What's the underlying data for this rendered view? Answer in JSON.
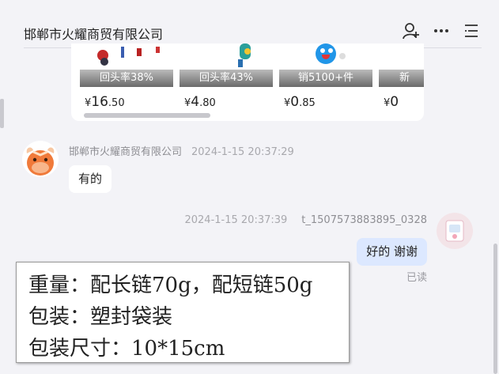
{
  "header": {
    "title": "邯郸市火耀商贸有限公司",
    "icons": [
      "add-user-icon",
      "more-icon",
      "menu-icon"
    ]
  },
  "products": [
    {
      "tag": "回头率38%",
      "price": {
        "currency": "¥",
        "int": "16",
        "dec": ".50"
      }
    },
    {
      "tag": "回头率43%",
      "price": {
        "currency": "¥",
        "int": "4",
        "dec": ".80"
      }
    },
    {
      "tag": "销5100+件",
      "price": {
        "currency": "¥",
        "int": "0",
        "dec": ".85"
      }
    },
    {
      "tag": "新",
      "price": {
        "currency": "¥",
        "int": "0",
        "dec": ""
      }
    }
  ],
  "messages": {
    "incoming": {
      "sender": "邯郸市火耀商贸有限公司",
      "time": "2024-1-15 20:37:29",
      "text": "有的"
    },
    "outgoing": {
      "sender": "t_1507573883895_0328",
      "time": "2024-1-15 20:37:39",
      "text": "好的 谢谢",
      "status": "已读"
    }
  },
  "overlay": {
    "lines": [
      "重量：配长链70g，配短链50g",
      "包装：塑封袋装",
      "包装尺寸：10*15cm"
    ]
  },
  "colors": {
    "background": "#f3f3f7",
    "outgoing_bubble": "#dce8ff",
    "avatar_orange": "#f07a3a"
  }
}
